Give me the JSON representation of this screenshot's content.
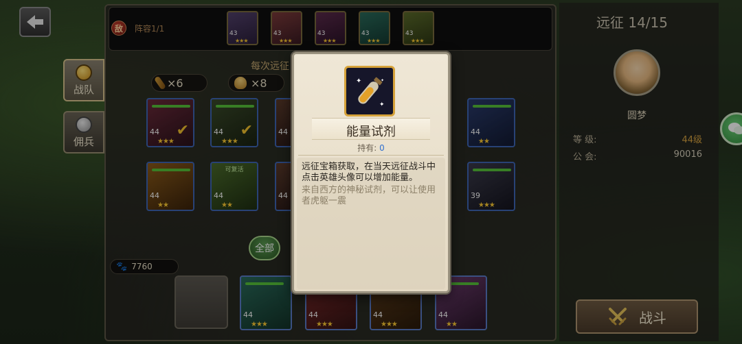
{
  "enemy_bar": {
    "badge": "敌",
    "lineup_label": "阵容1/1",
    "portraits": [
      {
        "level": "43",
        "stars": "★★★"
      },
      {
        "level": "43",
        "stars": "★★★"
      },
      {
        "level": "43",
        "stars": "★★★"
      },
      {
        "level": "43",
        "stars": "★★★"
      },
      {
        "level": "43",
        "stars": "★★★"
      }
    ]
  },
  "side_tabs": [
    {
      "label": "战队",
      "active": true
    },
    {
      "label": "佣兵",
      "active": false
    }
  ],
  "section": {
    "label": "每次远征"
  },
  "resources": [
    {
      "icon": "potion-icon",
      "count": "×6"
    },
    {
      "icon": "food-bowl-icon",
      "count": "×8"
    }
  ],
  "hero_grid": {
    "row1": [
      {
        "level": "44",
        "stars": "★★★",
        "checked": true
      },
      {
        "level": "44",
        "stars": "★★★",
        "checked": true
      },
      {
        "level": "44",
        "stars": "★★",
        "checked": false
      }
    ],
    "row1_right": {
      "level": "44",
      "stars": "★★"
    },
    "row2": [
      {
        "level": "44",
        "stars": "★★",
        "revive": ""
      },
      {
        "level": "44",
        "stars": "★★",
        "revive": "可复活"
      },
      {
        "level": "44",
        "stars": "",
        "revive": ""
      }
    ],
    "row2_right": {
      "level": "39",
      "stars": "★★★"
    }
  },
  "filter": {
    "all_label": "全部"
  },
  "power": {
    "value": "7760"
  },
  "team": [
    {
      "level": "44",
      "stars": "★★★"
    },
    {
      "level": "44",
      "stars": "★★★"
    },
    {
      "level": "44",
      "stars": "★★★"
    },
    {
      "level": "44",
      "stars": "★★"
    }
  ],
  "right_panel": {
    "title": "远征  14/15",
    "player_name": "圆梦",
    "level_label": "等    级:",
    "level_value": "44级",
    "guild_label": "公    会:",
    "guild_value": "90016",
    "fight_label": "战斗"
  },
  "modal": {
    "item_name": "能量试剂",
    "held_label": "持有:",
    "held_value": "0",
    "desc_main": "远征宝箱获取，在当天远征战斗中点击英雄头像可以增加能量。",
    "desc_sub": "来自西方的神秘试剂，可以让使用者虎躯一震"
  },
  "colors": {
    "level_value": "#d9a441",
    "guild_value": "#d8d0bc",
    "held_value": "#2f6fcf",
    "star": "#ffcc33"
  }
}
